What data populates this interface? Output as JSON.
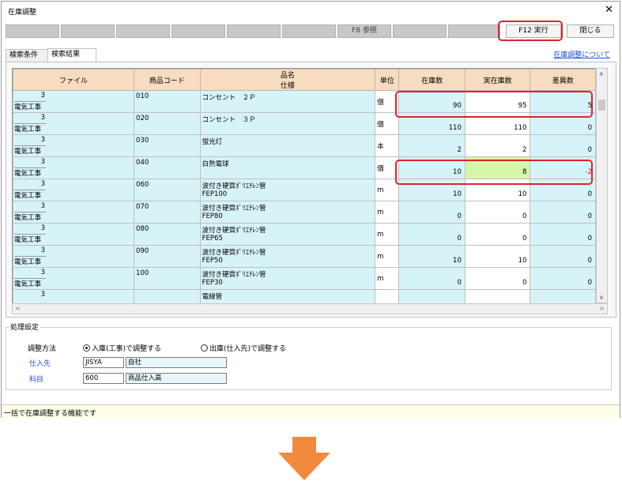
{
  "window": {
    "title": "在庫調整",
    "close_glyph": "✕"
  },
  "toolbar": {
    "keys": [
      "",
      "",
      "",
      "",
      "",
      "",
      "F8 参照",
      "",
      "",
      "F12 実行"
    ],
    "close_label": "閉じる"
  },
  "tabs": {
    "items": [
      "検索条件",
      "検索結果"
    ],
    "selected": "検索結果",
    "help_link": "在庫調整について"
  },
  "grid": {
    "headers": {
      "file": "ファイル",
      "code": "商品コード",
      "name": "品名",
      "spec": "仕様",
      "unit": "単位",
      "stock": "在庫数",
      "actual": "実在庫数",
      "diff": "差異数"
    },
    "rows": [
      {
        "num": "3",
        "file": "電気工事",
        "code": "010",
        "name": "コンセント　２Ｐ",
        "spec": "",
        "unit": "個",
        "stock": "90",
        "actual": "95",
        "diff": "5"
      },
      {
        "num": "3",
        "file": "電気工事",
        "code": "020",
        "name": "コンセント　３Ｐ",
        "spec": "",
        "unit": "個",
        "stock": "110",
        "actual": "110",
        "diff": "0"
      },
      {
        "num": "3",
        "file": "電気工事",
        "code": "030",
        "name": "蛍光灯",
        "spec": "",
        "unit": "本",
        "stock": "2",
        "actual": "2",
        "diff": "0"
      },
      {
        "num": "3",
        "file": "電気工事",
        "code": "040",
        "name": "白熱電球",
        "spec": "",
        "unit": "個",
        "stock": "10",
        "actual": "8",
        "diff": "-2"
      },
      {
        "num": "3",
        "file": "電気工事",
        "code": "060",
        "name": "波付き硬質ﾎﾟﾘｴﾁﾚﾝ管",
        "spec": "FEP100",
        "unit": "m",
        "stock": "10",
        "actual": "10",
        "diff": "0"
      },
      {
        "num": "3",
        "file": "電気工事",
        "code": "070",
        "name": "波付き硬質ﾎﾟﾘｴﾁﾚﾝ管",
        "spec": "FEP80",
        "unit": "m",
        "stock": "0",
        "actual": "0",
        "diff": "0"
      },
      {
        "num": "3",
        "file": "電気工事",
        "code": "080",
        "name": "波付き硬質ﾎﾟﾘｴﾁﾚﾝ管",
        "spec": "FEP65",
        "unit": "m",
        "stock": "0",
        "actual": "0",
        "diff": "0"
      },
      {
        "num": "3",
        "file": "電気工事",
        "code": "090",
        "name": "波付き硬質ﾎﾟﾘｴﾁﾚﾝ管",
        "spec": "FEP50",
        "unit": "m",
        "stock": "10",
        "actual": "10",
        "diff": "0"
      },
      {
        "num": "3",
        "file": "電気工事",
        "code": "100",
        "name": "波付き硬質ﾎﾟﾘｴﾁﾚﾝ管",
        "spec": "FEP30",
        "unit": "m",
        "stock": "0",
        "actual": "0",
        "diff": "0"
      },
      {
        "num": "3",
        "file": "",
        "code": "",
        "name": "電線管",
        "spec": "",
        "unit": "",
        "stock": "",
        "actual": "",
        "diff": ""
      }
    ]
  },
  "settings": {
    "legend": "処理設定",
    "method_label": "調整方法",
    "method_option_in": "入庫(工事)で調整する",
    "method_option_out": "出庫(仕入先)で調整する",
    "method_selected": "in",
    "supplier_label": "仕入先",
    "supplier_code": "JISYA",
    "supplier_name": "自社",
    "account_label": "科目",
    "account_code": "600",
    "account_name": "商品仕入高"
  },
  "status": {
    "message": "一括で在庫調整する機能です"
  },
  "colors": {
    "highlight": "#d9262c",
    "arrow": "#f08a3c",
    "header_bg": "#f8dcc0",
    "cell_bg": "#d6f3f8",
    "edited_bg": "#d6f7a8",
    "negative": "#e02020"
  }
}
